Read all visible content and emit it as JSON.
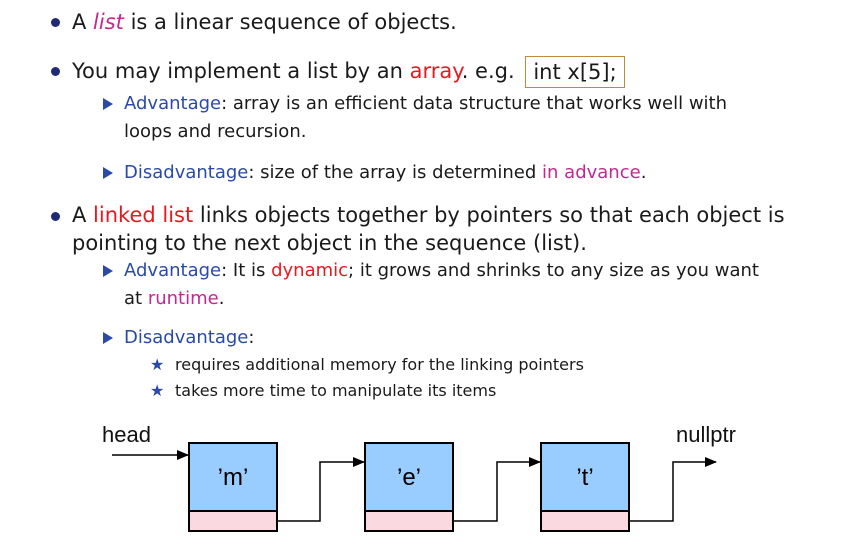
{
  "bullets": {
    "b1": {
      "prefix": "A ",
      "term": "list",
      "suffix": " is a linear sequence of objects."
    },
    "b2": {
      "prefix": "You may implement a list by an ",
      "term": "array",
      "mid": ". e.g. ",
      "code": "int x[5];"
    },
    "b2_sub1": {
      "term": "Advantage",
      "text1": ": array is an efficient data structure that works well with",
      "text2": "loops and recursion."
    },
    "b2_sub2": {
      "term": "Disadvantage",
      "text": ": size of the array is determined ",
      "highlight": "in advance",
      "end": "."
    },
    "b3": {
      "prefix": "A ",
      "term": "linked list",
      "text1": " links objects together by pointers so that each object is",
      "text2": "pointing to the next object in the sequence (list)."
    },
    "b3_sub1": {
      "term": "Advantage",
      "text1": ": It is ",
      "highlight1": "dynamic",
      "text2": "; it grows and shrinks to any size as you want",
      "text3": "at ",
      "highlight2": "runtime",
      "end": "."
    },
    "b3_sub2": {
      "term": "Disadvantage",
      "end": ":"
    },
    "b3_sub2_items": [
      "requires additional memory for the linking pointers",
      "takes more time to manipulate its items"
    ]
  },
  "diagram": {
    "head_label": "head",
    "null_label": "nullptr",
    "nodes": [
      "’m’",
      "’e’",
      "’t’"
    ],
    "colors": {
      "node_fill": "#99ccff",
      "pointer_fill": "#fad9e0",
      "stroke": "#000000"
    }
  },
  "colors": {
    "bullet": "#1e2a78",
    "accent_blue": "#2a4aa8",
    "accent_red": "#e8191e",
    "accent_magenta": "#c2298e",
    "code_border": "#c08a3a"
  }
}
